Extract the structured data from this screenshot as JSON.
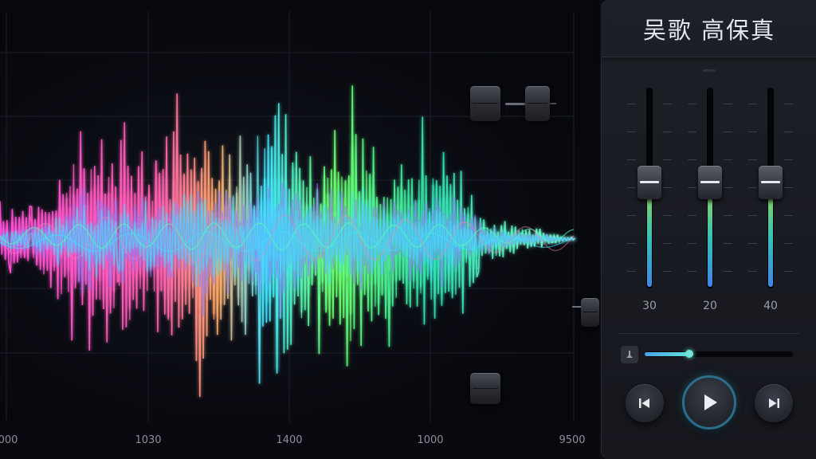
{
  "player": {
    "title": "吴歌 高保真",
    "faders": [
      {
        "label": "30",
        "level": 0.5
      },
      {
        "label": "20",
        "level": 0.5
      },
      {
        "label": "40",
        "level": 0.5
      }
    ],
    "progress": 0.3,
    "controls": {
      "prev_icon": "skip-previous-icon",
      "play_icon": "play-icon",
      "next_icon": "skip-next-icon",
      "volume_icon": "speaker-icon"
    }
  },
  "chart_data": {
    "type": "line",
    "x_ticks": [
      "000",
      "1030",
      "1400",
      "1000",
      "9500"
    ],
    "grid": true,
    "colors": [
      "#ff4fd8",
      "#c46bff",
      "#8a7dff",
      "#ff7fae",
      "#ffb070",
      "#3fe3ff",
      "#52ffb0",
      "#7bff5a",
      "#2fd6c8"
    ]
  }
}
